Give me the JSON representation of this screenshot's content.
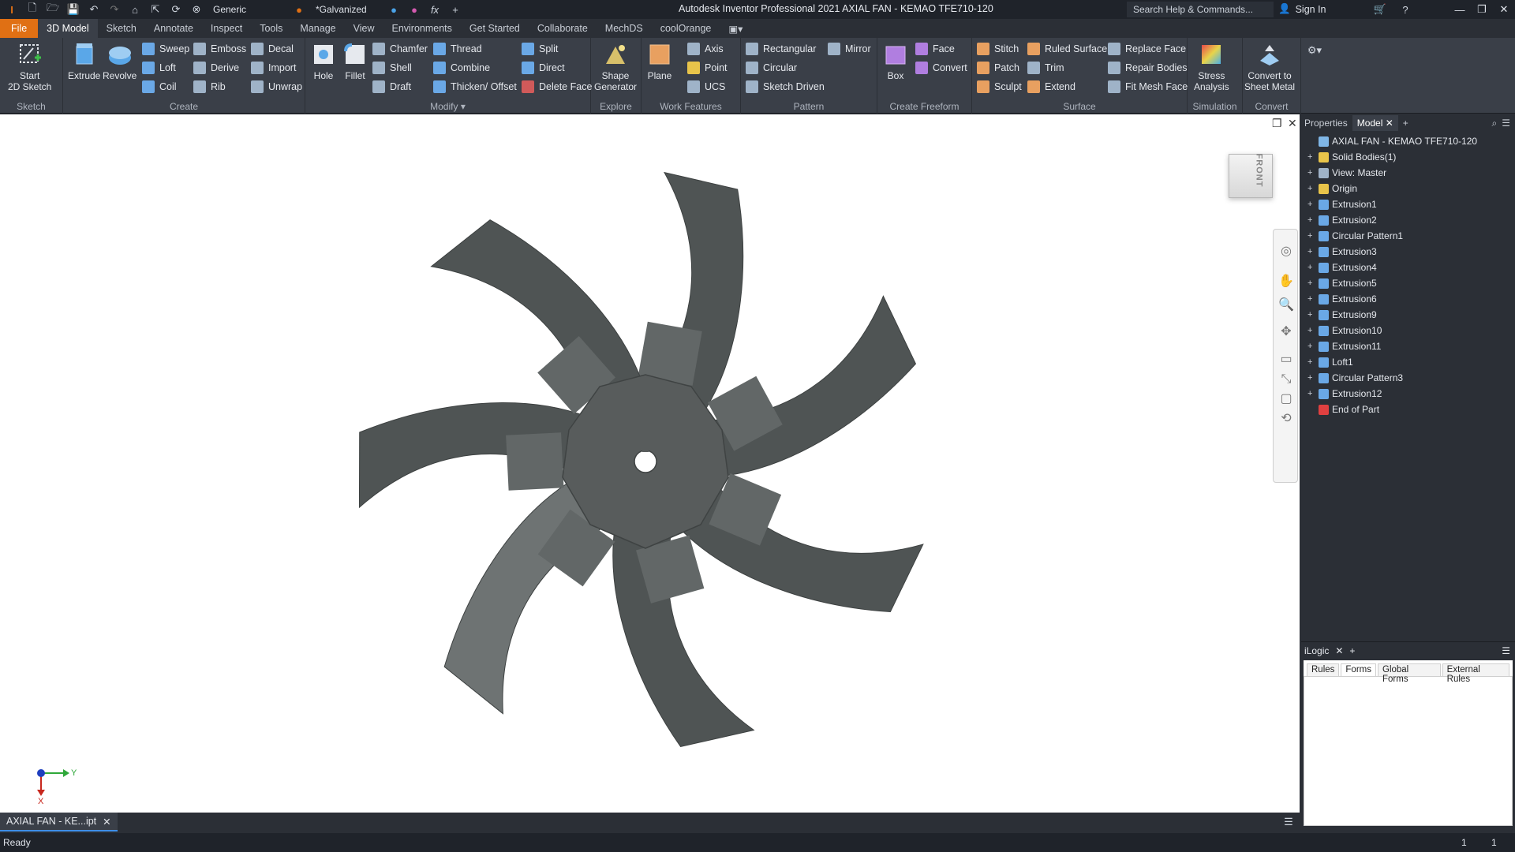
{
  "titlebar": {
    "app_title": "Autodesk Inventor Professional 2021   AXIAL FAN - KEMAO TFE710-120",
    "appearance_select": "Generic",
    "material_select": "*Galvanized",
    "search_placeholder": "Search Help & Commands...",
    "sign_in": "Sign In"
  },
  "menu": {
    "file": "File",
    "tabs": [
      "3D Model",
      "Sketch",
      "Annotate",
      "Inspect",
      "Tools",
      "Manage",
      "View",
      "Environments",
      "Get Started",
      "Collaborate",
      "MechDS",
      "coolOrange"
    ]
  },
  "ribbon": {
    "sketch": {
      "start": "Start",
      "start2": "2D Sketch",
      "label": "Sketch"
    },
    "create": {
      "extrude": "Extrude",
      "revolve": "Revolve",
      "sweep": "Sweep",
      "loft": "Loft",
      "coil": "Coil",
      "emboss": "Emboss",
      "derive": "Derive",
      "rib": "Rib",
      "decal": "Decal",
      "import": "Import",
      "unwrap": "Unwrap",
      "label": "Create"
    },
    "modify": {
      "hole": "Hole",
      "fillet": "Fillet",
      "chamfer": "Chamfer",
      "shell": "Shell",
      "draft": "Draft",
      "thread": "Thread",
      "combine": "Combine",
      "thicken": "Thicken/ Offset",
      "split": "Split",
      "direct": "Direct",
      "delete_face": "Delete Face",
      "label": "Modify"
    },
    "explore": {
      "shape1": "Shape",
      "shape2": "Generator",
      "label": "Explore"
    },
    "work": {
      "plane": "Plane",
      "axis": "Axis",
      "point": "Point",
      "ucs": "UCS",
      "label": "Work Features"
    },
    "pattern": {
      "rect": "Rectangular",
      "circular": "Circular",
      "sketch_driven": "Sketch Driven",
      "mirror": "Mirror",
      "label": "Pattern"
    },
    "freeform": {
      "box": "Box",
      "face": "Face",
      "convert": "Convert",
      "label": "Create Freeform"
    },
    "surface": {
      "stitch": "Stitch",
      "patch": "Patch",
      "sculpt": "Sculpt",
      "ruled": "Ruled Surface",
      "trim": "Trim",
      "extend": "Extend",
      "replace": "Replace Face",
      "repair": "Repair Bodies",
      "fit": "Fit Mesh Face",
      "label": "Surface"
    },
    "simulation": {
      "stress1": "Stress",
      "stress2": "Analysis",
      "label": "Simulation"
    },
    "convert": {
      "c1": "Convert to",
      "c2": "Sheet Metal",
      "label": "Convert"
    }
  },
  "viewport": {
    "viewcube_face": "FRONT",
    "axis_y": "Y",
    "axis_x": "X"
  },
  "browser": {
    "tabs": [
      "Properties",
      "Model"
    ],
    "items": [
      {
        "label": "AXIAL FAN - KEMAO TFE710-120",
        "icon": "part-icon",
        "color": "#7fb6e6"
      },
      {
        "label": "Solid Bodies(1)",
        "icon": "folder-icon",
        "color": "#e8c44a"
      },
      {
        "label": "View: Master",
        "icon": "view-icon",
        "color": "#9fb3c8"
      },
      {
        "label": "Origin",
        "icon": "folder-icon",
        "color": "#e8c44a"
      },
      {
        "label": "Extrusion1",
        "icon": "extrusion-icon",
        "color": "#6aa8e6"
      },
      {
        "label": "Extrusion2",
        "icon": "extrusion-icon",
        "color": "#6aa8e6"
      },
      {
        "label": "Circular Pattern1",
        "icon": "pattern-icon",
        "color": "#6aa8e6"
      },
      {
        "label": "Extrusion3",
        "icon": "extrusion-icon",
        "color": "#6aa8e6"
      },
      {
        "label": "Extrusion4",
        "icon": "extrusion-icon",
        "color": "#6aa8e6"
      },
      {
        "label": "Extrusion5",
        "icon": "extrusion-icon",
        "color": "#6aa8e6"
      },
      {
        "label": "Extrusion6",
        "icon": "extrusion-icon",
        "color": "#6aa8e6"
      },
      {
        "label": "Extrusion9",
        "icon": "extrusion-icon",
        "color": "#6aa8e6"
      },
      {
        "label": "Extrusion10",
        "icon": "extrusion-icon",
        "color": "#6aa8e6"
      },
      {
        "label": "Extrusion11",
        "icon": "extrusion-icon",
        "color": "#6aa8e6"
      },
      {
        "label": "Loft1",
        "icon": "loft-icon",
        "color": "#6aa8e6"
      },
      {
        "label": "Circular Pattern3",
        "icon": "pattern-icon",
        "color": "#6aa8e6"
      },
      {
        "label": "Extrusion12",
        "icon": "extrusion-icon",
        "color": "#6aa8e6"
      },
      {
        "label": "End of Part",
        "icon": "end-of-part-icon",
        "color": "#e04040"
      }
    ]
  },
  "ilogic": {
    "title": "iLogic",
    "tabs": [
      "Rules",
      "Forms",
      "Global Forms",
      "External Rules"
    ]
  },
  "doc_tab": "AXIAL FAN - KE...ipt",
  "status": {
    "text": "Ready",
    "n1": "1",
    "n2": "1"
  },
  "colors": {
    "accent": "#e07014",
    "blade": "#4f5454",
    "hub": "#585c5c"
  }
}
